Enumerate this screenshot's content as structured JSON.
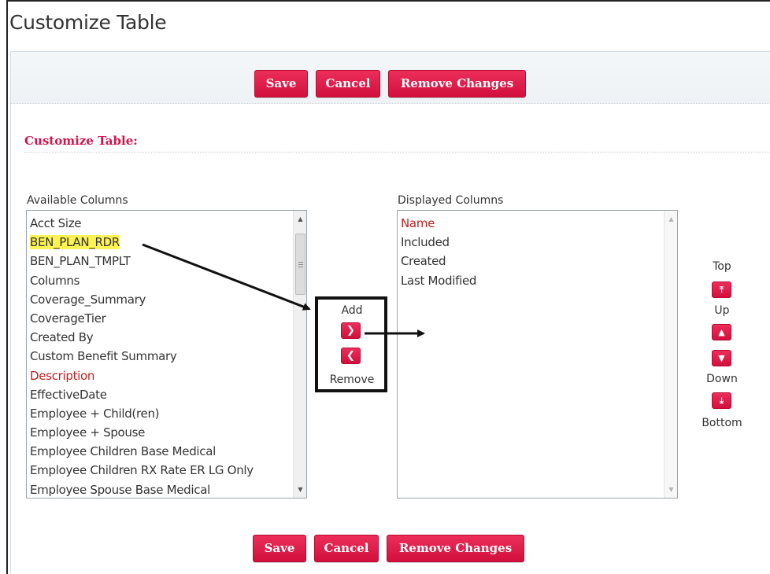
{
  "page": {
    "title": "Customize Table"
  },
  "toolbar": {
    "save_label": "Save",
    "cancel_label": "Cancel",
    "remove_changes_label": "Remove Changes"
  },
  "section": {
    "label": "Customize Table:"
  },
  "available": {
    "label": "Available Columns",
    "items": [
      {
        "label": "Acct Size",
        "required": false
      },
      {
        "label": "BEN_PLAN_RDR",
        "required": false,
        "highlighted": true
      },
      {
        "label": "BEN_PLAN_TMPLT",
        "required": false
      },
      {
        "label": "Columns",
        "required": false
      },
      {
        "label": "Coverage_Summary",
        "required": false
      },
      {
        "label": "CoverageTier",
        "required": false
      },
      {
        "label": "Created By",
        "required": false
      },
      {
        "label": "Custom Benefit Summary",
        "required": false
      },
      {
        "label": "Description",
        "required": true
      },
      {
        "label": "EffectiveDate",
        "required": false
      },
      {
        "label": "Employee + Child(ren)",
        "required": false
      },
      {
        "label": "Employee + Spouse",
        "required": false
      },
      {
        "label": "Employee Children Base Medical",
        "required": false
      },
      {
        "label": "Employee Children RX Rate ER LG Only",
        "required": false
      },
      {
        "label": "Employee Spouse Base Medical",
        "required": false
      }
    ]
  },
  "displayed": {
    "label": "Displayed Columns",
    "items": [
      {
        "label": "Name",
        "required": true
      },
      {
        "label": "Included",
        "required": false
      },
      {
        "label": "Created",
        "required": false
      },
      {
        "label": "Last Modified",
        "required": false
      }
    ]
  },
  "transfer": {
    "add_label": "Add",
    "remove_label": "Remove",
    "add_icon": "chevron-right-icon",
    "remove_icon": "chevron-left-icon"
  },
  "order": {
    "top_label": "Top",
    "up_label": "Up",
    "down_label": "Down",
    "bottom_label": "Bottom",
    "top_icon": "double-chevron-up-icon",
    "up_icon": "chevron-up-icon",
    "down_icon": "chevron-down-icon",
    "bottom_icon": "double-chevron-down-icon"
  },
  "colors": {
    "accent": "#d6134a",
    "required_text": "#c41e1e",
    "highlight": "#fdf352",
    "annotation": "#111111"
  }
}
